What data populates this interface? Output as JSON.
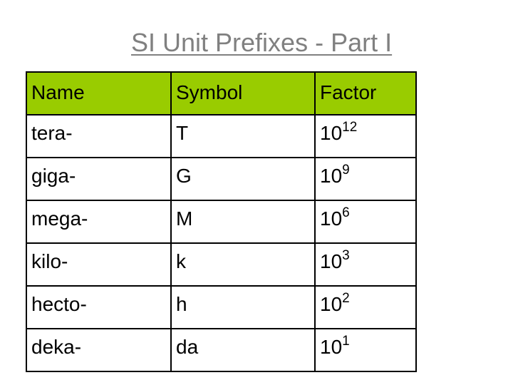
{
  "title": "SI Unit Prefixes - Part I",
  "colors": {
    "header_bg": "#99cc00",
    "title": "#808080",
    "border": "#000000"
  },
  "table": {
    "headers": [
      "Name",
      "Symbol",
      "Factor"
    ],
    "rows": [
      {
        "name": "tera-",
        "symbol": "T",
        "base": "10",
        "exp": "12"
      },
      {
        "name": "giga-",
        "symbol": "G",
        "base": "10",
        "exp": "9"
      },
      {
        "name": "mega-",
        "symbol": "M",
        "base": "10",
        "exp": "6"
      },
      {
        "name": "kilo-",
        "symbol": "k",
        "base": "10",
        "exp": "3"
      },
      {
        "name": "hecto-",
        "symbol": "h",
        "base": "10",
        "exp": "2"
      },
      {
        "name": "deka-",
        "symbol": "da",
        "base": "10",
        "exp": "1"
      }
    ]
  }
}
